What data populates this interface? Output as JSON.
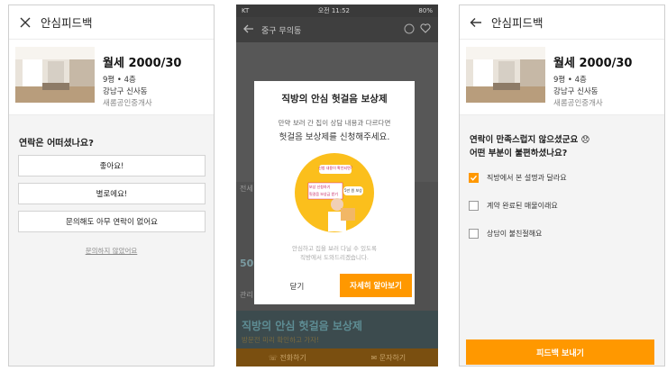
{
  "screen1": {
    "header_title": "안심피드백",
    "property": {
      "title": "월세 2000/30",
      "size_floor": "9평 • 4층",
      "address": "강남구 신사동",
      "agent": "새롬공인중개사"
    },
    "question": "연락은 어떠셨나요?",
    "options": [
      "좋아요!",
      "별로에요!",
      "문의해도 아무 연락이 없어요"
    ],
    "skip_link": "문의하지 않았어요"
  },
  "screen2": {
    "status": {
      "carrier": "KT",
      "time": "오전 11:52",
      "battery": "80%"
    },
    "header_title": "중구 무의동",
    "modal": {
      "title": "직방의 안심 헛걸음 보상제",
      "sub1": "만약 보러 간 집이 상담 내용과 다르다면",
      "sub2": "헛걸음 보상제를 신청해주세요.",
      "note1": "안심하고 집을 보러 다닐 수 있도록",
      "note2": "직방에서 도와드리겠습니다.",
      "close_label": "닫기",
      "more_label": "자세히 알아보기",
      "illus_bubble1": "신청 내용이 확인되면?",
      "illus_bubble2": "보상 신청하기",
      "illus_bubble3": "헛걸음 보상금 받기",
      "illus_bubble4": "5만 원 보상"
    },
    "bg": {
      "banner_title": "직방의 안심 헛걸음 보상제",
      "banner_sub": "방문전 미리 확인하고 가자!",
      "call": "전화하기",
      "message": "문자하기",
      "peek_value": "50",
      "peek_label": "관리",
      "side_label": "전세"
    }
  },
  "screen3": {
    "header_title": "안심피드백",
    "property": {
      "title": "월세 2000/30",
      "size_floor": "9평 • 4층",
      "address": "강남구 신사동",
      "agent": "새롬공인중개사"
    },
    "question_line1": "연락이 만족스럽지 않으셨군요 😞",
    "question_line2": "어떤 부분이 불편하셨나요?",
    "checks": [
      {
        "label": "직방에서 본 설명과 달라요",
        "checked": true
      },
      {
        "label": "계약 완료된 매물이래요",
        "checked": false
      },
      {
        "label": "상담이 불친절해요",
        "checked": false
      }
    ],
    "submit_label": "피드백 보내기"
  },
  "colors": {
    "accent": "#ff9800",
    "bg": "#f4f4f4",
    "dim": "#4b4b4b"
  },
  "icons": [
    "close-icon",
    "back-arrow-icon",
    "heart-icon",
    "check-icon",
    "phone-icon",
    "message-icon"
  ]
}
